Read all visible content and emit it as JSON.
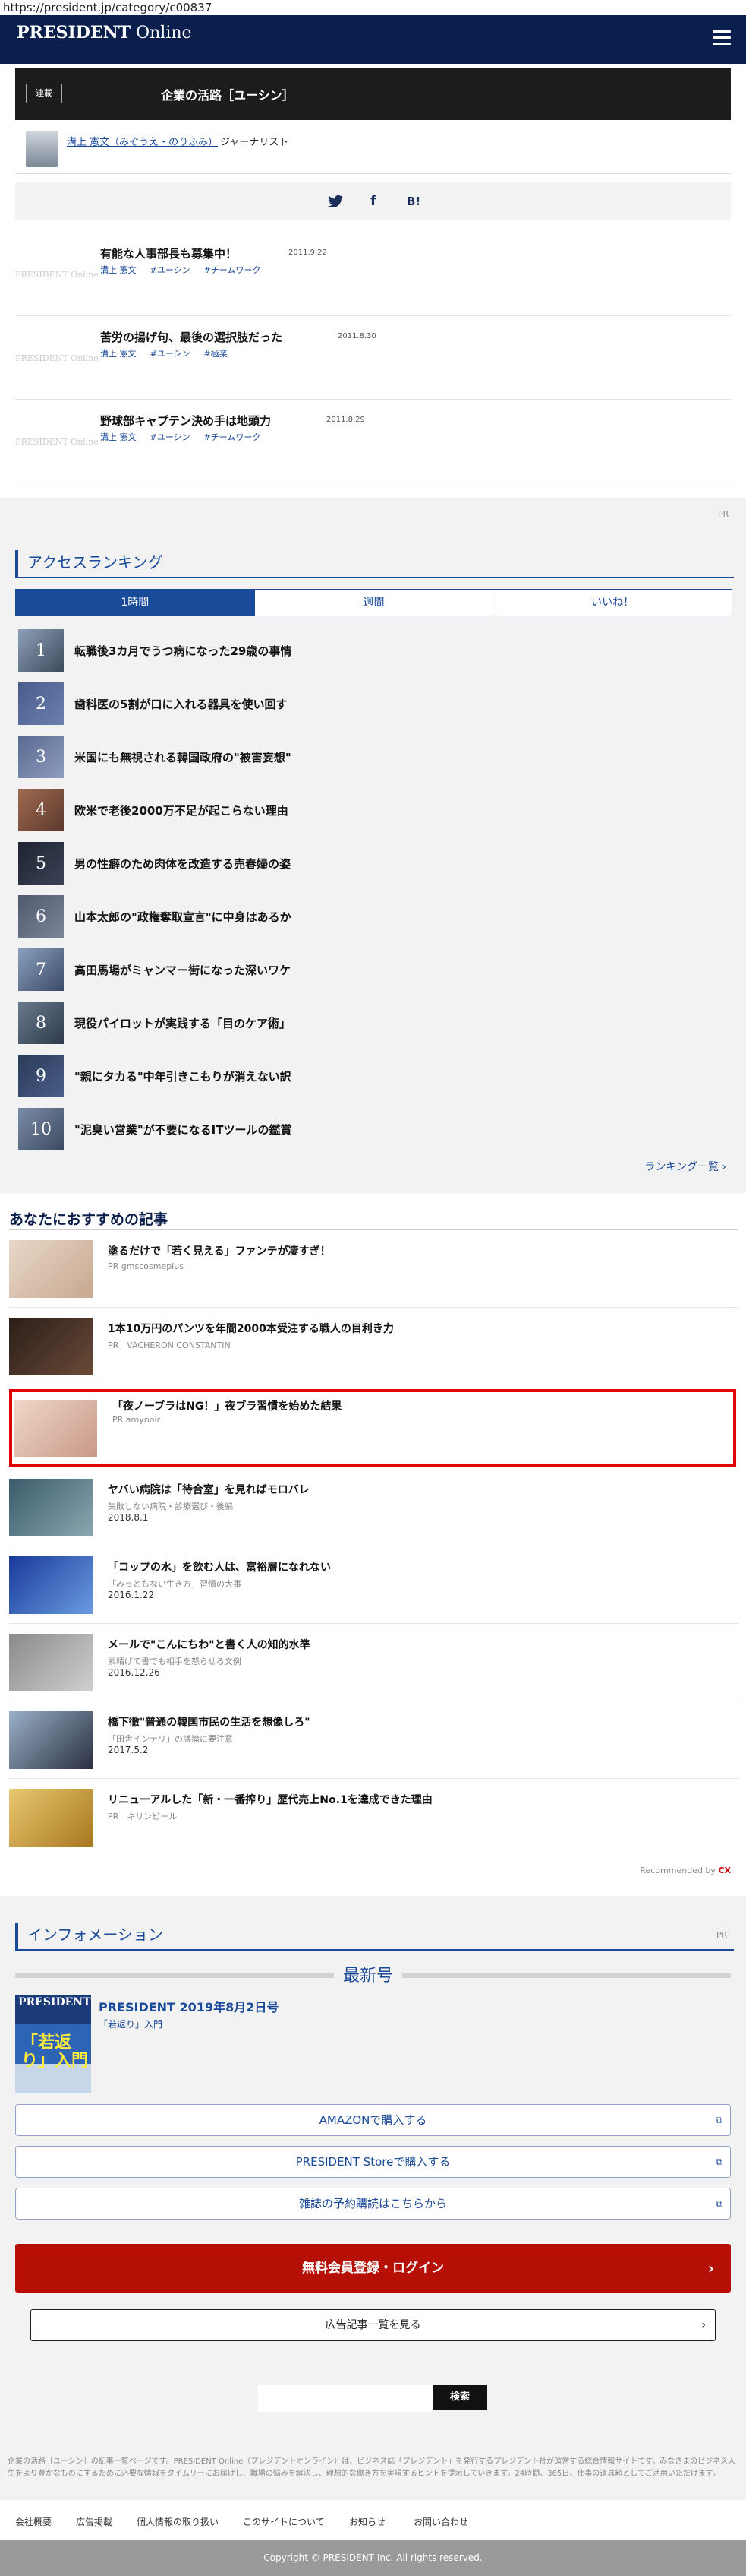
{
  "url": "https://president.jp/category/c00837",
  "header": {
    "logo_main": "PRESIDENT",
    "logo_sub": " Online"
  },
  "serial": {
    "tag": "連載",
    "title": "企業の活路［ユーシン］",
    "author_name": "溝上 憲文（みぞうえ・のりふみ）",
    "author_role": "ジャーナリスト"
  },
  "share": {
    "twitter": "🐦",
    "facebook": "f",
    "hatena": "B!"
  },
  "articles": [
    {
      "thumb": "PRESIDENT Online",
      "title": "有能な人事部長も募集中！",
      "date": "2011.9.22",
      "tags": [
        "溝上 憲文",
        "#ユーシン",
        "#チームワーク"
      ]
    },
    {
      "thumb": "PRESIDENT Online",
      "title": "苦労の揚げ句、最後の選択肢だった",
      "date": "2011.8.30",
      "tags": [
        "溝上 憲文",
        "#ユーシン",
        "#極楽"
      ]
    },
    {
      "thumb": "PRESIDENT Online",
      "title": "野球部キャプテン決め手は地頭力",
      "date": "2011.8.29",
      "tags": [
        "溝上 憲文",
        "#ユーシン",
        "#チームワーク"
      ]
    }
  ],
  "pr_label": "PR",
  "ranking": {
    "title": "アクセスランキング",
    "tabs": [
      "1時間",
      "週間",
      "いいね！"
    ],
    "items": [
      {
        "rank": "1",
        "title": "転職後3カ月でうつ病になった29歳の事情"
      },
      {
        "rank": "2",
        "title": "歯科医の5割が口に入れる器具を使い回す"
      },
      {
        "rank": "3",
        "title": "米国にも無視される韓国政府の\"被害妄想\""
      },
      {
        "rank": "4",
        "title": "欧米で老後2000万不足が起こらない理由"
      },
      {
        "rank": "5",
        "title": "男の性癖のため肉体を改造する売春婦の姿"
      },
      {
        "rank": "6",
        "title": "山本太郎の\"政権奪取宣言\"に中身はあるか"
      },
      {
        "rank": "7",
        "title": "高田馬場がミャンマー街になった深いワケ"
      },
      {
        "rank": "8",
        "title": "現役パイロットが実践する「目のケア術」"
      },
      {
        "rank": "9",
        "title": "\"親にタカる\"中年引きこもりが消えない訳"
      },
      {
        "rank": "10",
        "title": "\"泥臭い営業\"が不要になるITツールの鑑賞"
      }
    ],
    "more": "ランキング一覧 ›"
  },
  "recommend": {
    "title": "あなたにおすすめの記事",
    "items": [
      {
        "title": "塗るだけで「若く見える」ファンテが凄すぎ！",
        "source": "PR gmscosmeplus",
        "date": ""
      },
      {
        "title": "1本10万円のパンツを年間2000本受注する職人の目利き力",
        "source": "PR　VACHERON CONSTANTIN",
        "date": ""
      },
      {
        "title": "「夜ノーブラはNG！」夜ブラ習慣を始めた結果",
        "source": "PR amynoir",
        "date": ""
      },
      {
        "title": "ヤバい病院は「待合室」を見ればモロバレ",
        "source": "失敗しない病院・診療選び・後編",
        "date": "2018.8.1"
      },
      {
        "title": "「コップの水」を飲む人は、富裕層になれない",
        "source": "「みっともない生き方」習慣の大事",
        "date": "2016.1.22"
      },
      {
        "title": "メールで\"こんにちわ\"と書く人の知的水準",
        "source": "素晴げて書でも相手を怒らせる文例",
        "date": "2016.12.26"
      },
      {
        "title": "橋下徹\"普通の韓国市民の生活を想像しろ\"",
        "source": "「田舎インテリ」の議論に要注意",
        "date": "2017.5.2"
      },
      {
        "title": "リニューアルした「新・一番搾り」歴代売上No.1を達成できた理由",
        "source": "PR　キリンビール",
        "date": ""
      }
    ],
    "credit": "Recommended by",
    "credit_logo": "CX"
  },
  "info": {
    "title": "インフォメーション",
    "latest": "最新号",
    "cover_title": "PRESIDENT",
    "cover_headline": "「若返り」入門",
    "mag_title": "PRESIDENT 2019年8月2日号",
    "mag_sub": "「若返り」入門",
    "buttons": [
      "AMAZONで購入する",
      "PRESIDENT Storeで購入する",
      "雑誌の予約購読はこちらから"
    ],
    "login": "無料会員登録・ログイン",
    "ad_list": "広告記事一覧を見る",
    "search_placeholder": "",
    "search_button": "検索",
    "description": "企業の活路［ユーシン］の記事一覧ページです。PRESIDENT Online（プレジデントオンライン）は、ビジネス誌「プレジデント」を発行するプレジデント社が運営する総合情報サイトです。みなさまのビジネス人生をより豊かなものにするために必要な情報をタイムリーにお届けし、職場の悩みを解決し、理想的な働き方を実現するヒントを提示していきます。24時間、365日、仕事の道具箱としてご活用いただけます。"
  },
  "footer": {
    "links": [
      "会社概要",
      "広告掲載",
      "個人情報の取り扱い",
      "このサイトについて",
      "お知らせ",
      "お問い合わせ"
    ],
    "copyright": "Copyright © PRESIDENT Inc. All rights reserved."
  },
  "colors": {
    "navy": "#0b1f4d",
    "accent_blue": "#1a4a9a",
    "login_red": "#b50f06",
    "highlight_red": "#e00000"
  }
}
